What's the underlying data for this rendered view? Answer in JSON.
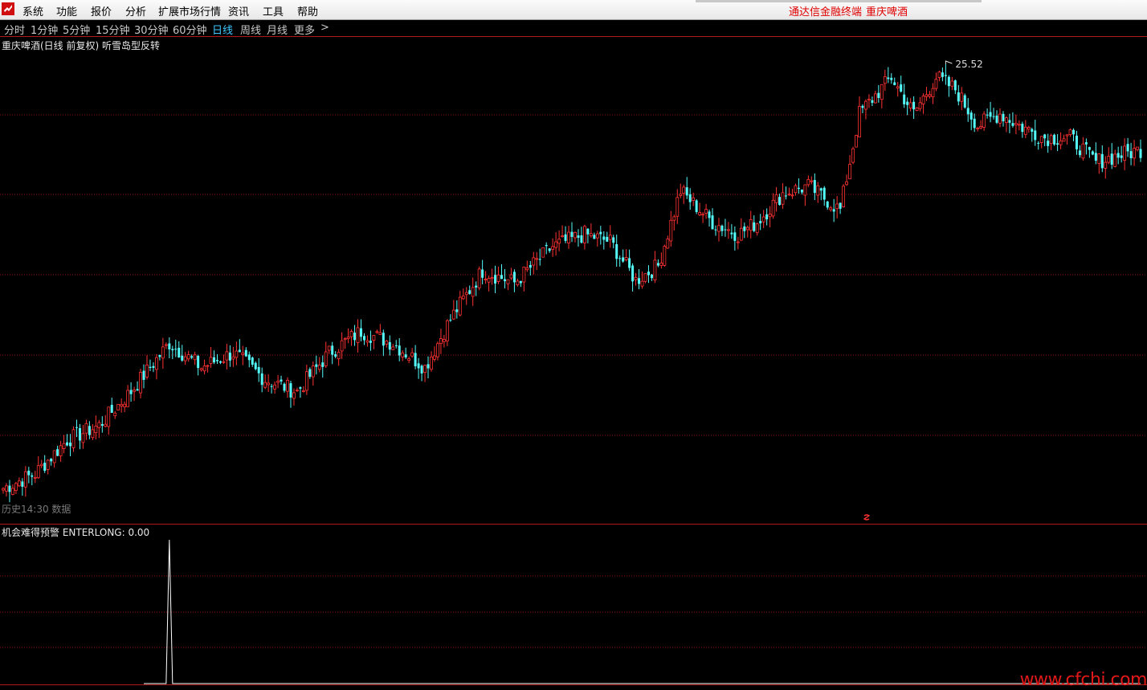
{
  "menu": {
    "items": [
      "系统",
      "功能",
      "报价",
      "分析",
      "扩展市场行情",
      "资讯",
      "工具",
      "帮助"
    ],
    "app_title": "通达信金融终端",
    "ticker": "重庆啤酒"
  },
  "periods": {
    "items": [
      "分时",
      "1分钟",
      "5分钟",
      "15分钟",
      "30分钟",
      "60分钟",
      "日线",
      "周线",
      "月线",
      "更多"
    ],
    "active": "日线",
    "more_arrow": ">"
  },
  "main_panel": {
    "title": "重庆啤酒(日线 前复权) 听雪岛型反转",
    "status": "历史14:30 数据",
    "high_label": "25.52"
  },
  "sub_panel": {
    "title": "机会难得预警  ENTERLONG: 0.00"
  },
  "watermark": "www.cfchi.com",
  "colors": {
    "up": "#ff3232",
    "down": "#54fcfc",
    "grid": "#8a1010",
    "active_period": "#3ec8ff",
    "menu_accent": "#e00000",
    "signal": "#ffffff"
  },
  "chart_data": {
    "type": "candlestick",
    "ohlc_anchors": [
      {
        "i": 0,
        "close": 8.0
      },
      {
        "i": 10,
        "close": 8.6
      },
      {
        "i": 20,
        "close": 10.0
      },
      {
        "i": 30,
        "close": 10.6
      },
      {
        "i": 40,
        "close": 12.0
      },
      {
        "i": 52,
        "close": 14.0
      },
      {
        "i": 62,
        "close": 13.0
      },
      {
        "i": 72,
        "close": 13.6
      },
      {
        "i": 82,
        "close": 12.5
      },
      {
        "i": 92,
        "close": 12.0
      },
      {
        "i": 102,
        "close": 13.6
      },
      {
        "i": 112,
        "close": 14.5
      },
      {
        "i": 122,
        "close": 14.0
      },
      {
        "i": 132,
        "close": 13.0
      },
      {
        "i": 140,
        "close": 15.0
      },
      {
        "i": 150,
        "close": 17.0
      },
      {
        "i": 160,
        "close": 16.5
      },
      {
        "i": 172,
        "close": 18.0
      },
      {
        "i": 182,
        "close": 18.5
      },
      {
        "i": 190,
        "close": 18.2
      },
      {
        "i": 198,
        "close": 16.6
      },
      {
        "i": 205,
        "close": 17.2
      },
      {
        "i": 212,
        "close": 20.3
      },
      {
        "i": 222,
        "close": 19.0
      },
      {
        "i": 230,
        "close": 18.5
      },
      {
        "i": 236,
        "close": 19.0
      },
      {
        "i": 244,
        "close": 20.2
      },
      {
        "i": 252,
        "close": 20.5
      },
      {
        "i": 262,
        "close": 19.5
      },
      {
        "i": 268,
        "close": 23.5
      },
      {
        "i": 278,
        "close": 25.0
      },
      {
        "i": 285,
        "close": 23.5
      },
      {
        "i": 292,
        "close": 25.0
      },
      {
        "i": 298,
        "close": 24.5
      },
      {
        "i": 305,
        "close": 23.0
      },
      {
        "i": 312,
        "close": 23.5
      },
      {
        "i": 318,
        "close": 23.0
      },
      {
        "i": 326,
        "close": 22.5
      },
      {
        "i": 334,
        "close": 22.5
      },
      {
        "i": 342,
        "close": 21.5
      },
      {
        "i": 350,
        "close": 21.8
      },
      {
        "i": 356,
        "close": 22.0
      }
    ],
    "bar_count": 357,
    "price_range": [
      7.2,
      26.0
    ],
    "grid_on": true,
    "labeled_high": 25.52
  },
  "signal_data": {
    "type": "line",
    "values_note": "ENTERLONG spike",
    "spike_index": 52,
    "spike_value": 1,
    "baseline_start": 44,
    "baseline_end": 356
  }
}
